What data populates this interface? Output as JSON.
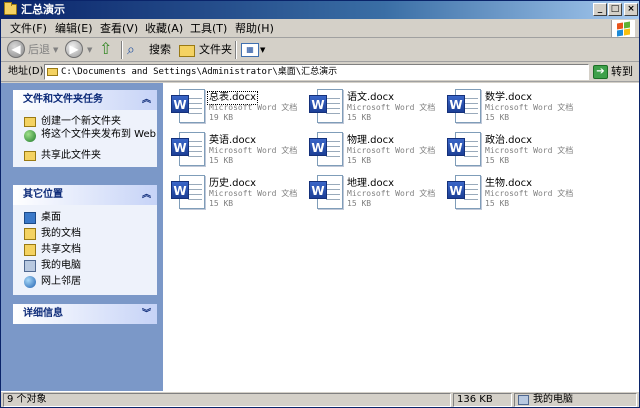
{
  "window": {
    "title": "汇总演示"
  },
  "menu": [
    "文件(F)",
    "编辑(E)",
    "查看(V)",
    "收藏(A)",
    "工具(T)",
    "帮助(H)"
  ],
  "toolbar": {
    "back": "后退",
    "search": "搜索",
    "folders": "文件夹"
  },
  "address": {
    "label": "地址(D)",
    "path": "C:\\Documents and Settings\\Administrator\\桌面\\汇总演示",
    "go": "转到"
  },
  "tasks": {
    "title": "文件和文件夹任务",
    "items": [
      "创建一个新文件夹",
      "将这个文件夹发布到 Web",
      "共享此文件夹"
    ]
  },
  "places": {
    "title": "其它位置",
    "items": [
      "桌面",
      "我的文档",
      "共享文档",
      "我的电脑",
      "网上邻居"
    ]
  },
  "details": {
    "title": "详细信息"
  },
  "files": [
    {
      "name": "总表.docx",
      "type": "Microsoft Word 文档",
      "size": "19 KB"
    },
    {
      "name": "语文.docx",
      "type": "Microsoft Word 文档",
      "size": "15 KB"
    },
    {
      "name": "数学.docx",
      "type": "Microsoft Word 文档",
      "size": "15 KB"
    },
    {
      "name": "英语.docx",
      "type": "Microsoft Word 文档",
      "size": "15 KB"
    },
    {
      "name": "物理.docx",
      "type": "Microsoft Word 文档",
      "size": "15 KB"
    },
    {
      "name": "政治.docx",
      "type": "Microsoft Word 文档",
      "size": "15 KB"
    },
    {
      "name": "历史.docx",
      "type": "Microsoft Word 文档",
      "size": "15 KB"
    },
    {
      "name": "地理.docx",
      "type": "Microsoft Word 文档",
      "size": "15 KB"
    },
    {
      "name": "生物.docx",
      "type": "Microsoft Word 文档",
      "size": "15 KB"
    }
  ],
  "status": {
    "count": "9 个对象",
    "size": "136 KB",
    "location": "我的电脑"
  },
  "colors": {
    "titlebar": "#0a246a",
    "sidebar": "#7b98c8",
    "word_badge": "#2b52b4"
  }
}
